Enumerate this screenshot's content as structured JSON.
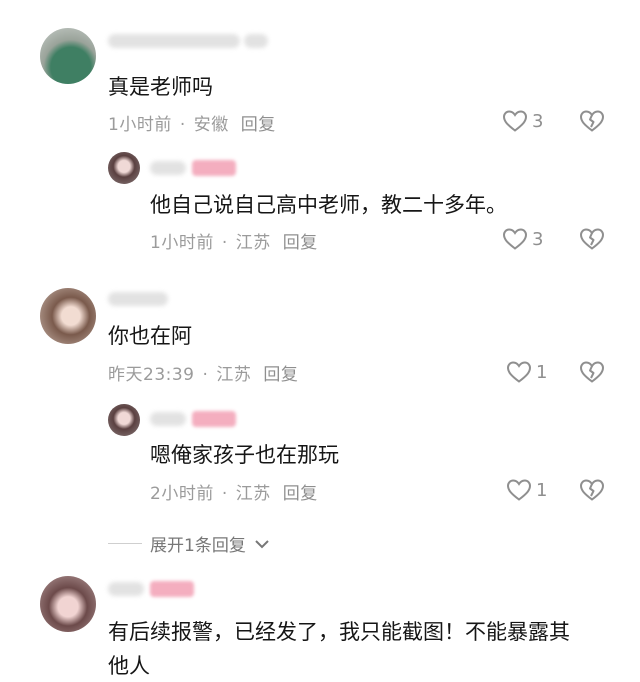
{
  "comments": [
    {
      "text": "真是老师吗",
      "time": "1小时前",
      "location": "安徽",
      "reply_label": "回复",
      "likes": "3",
      "reply": {
        "text": "他自己说自己高中老师，教二十多年。",
        "time": "1小时前",
        "location": "江苏",
        "reply_label": "回复",
        "likes": "3"
      }
    },
    {
      "text": "你也在阿",
      "time": "昨天23:39",
      "location": "江苏",
      "reply_label": "回复",
      "likes": "1",
      "reply": {
        "text": "嗯俺家孩子也在那玩",
        "time": "2小时前",
        "location": "江苏",
        "reply_label": "回复",
        "likes": "1"
      },
      "expand_label": "展开1条回复"
    },
    {
      "text_line1": "有后续报警，已经发了，我只能截图！不能暴露其",
      "text_line2": "他人"
    }
  ],
  "icons": {
    "like": "heart-outline-icon",
    "dislike": "broken-heart-icon",
    "expand": "chevron-down-icon"
  }
}
